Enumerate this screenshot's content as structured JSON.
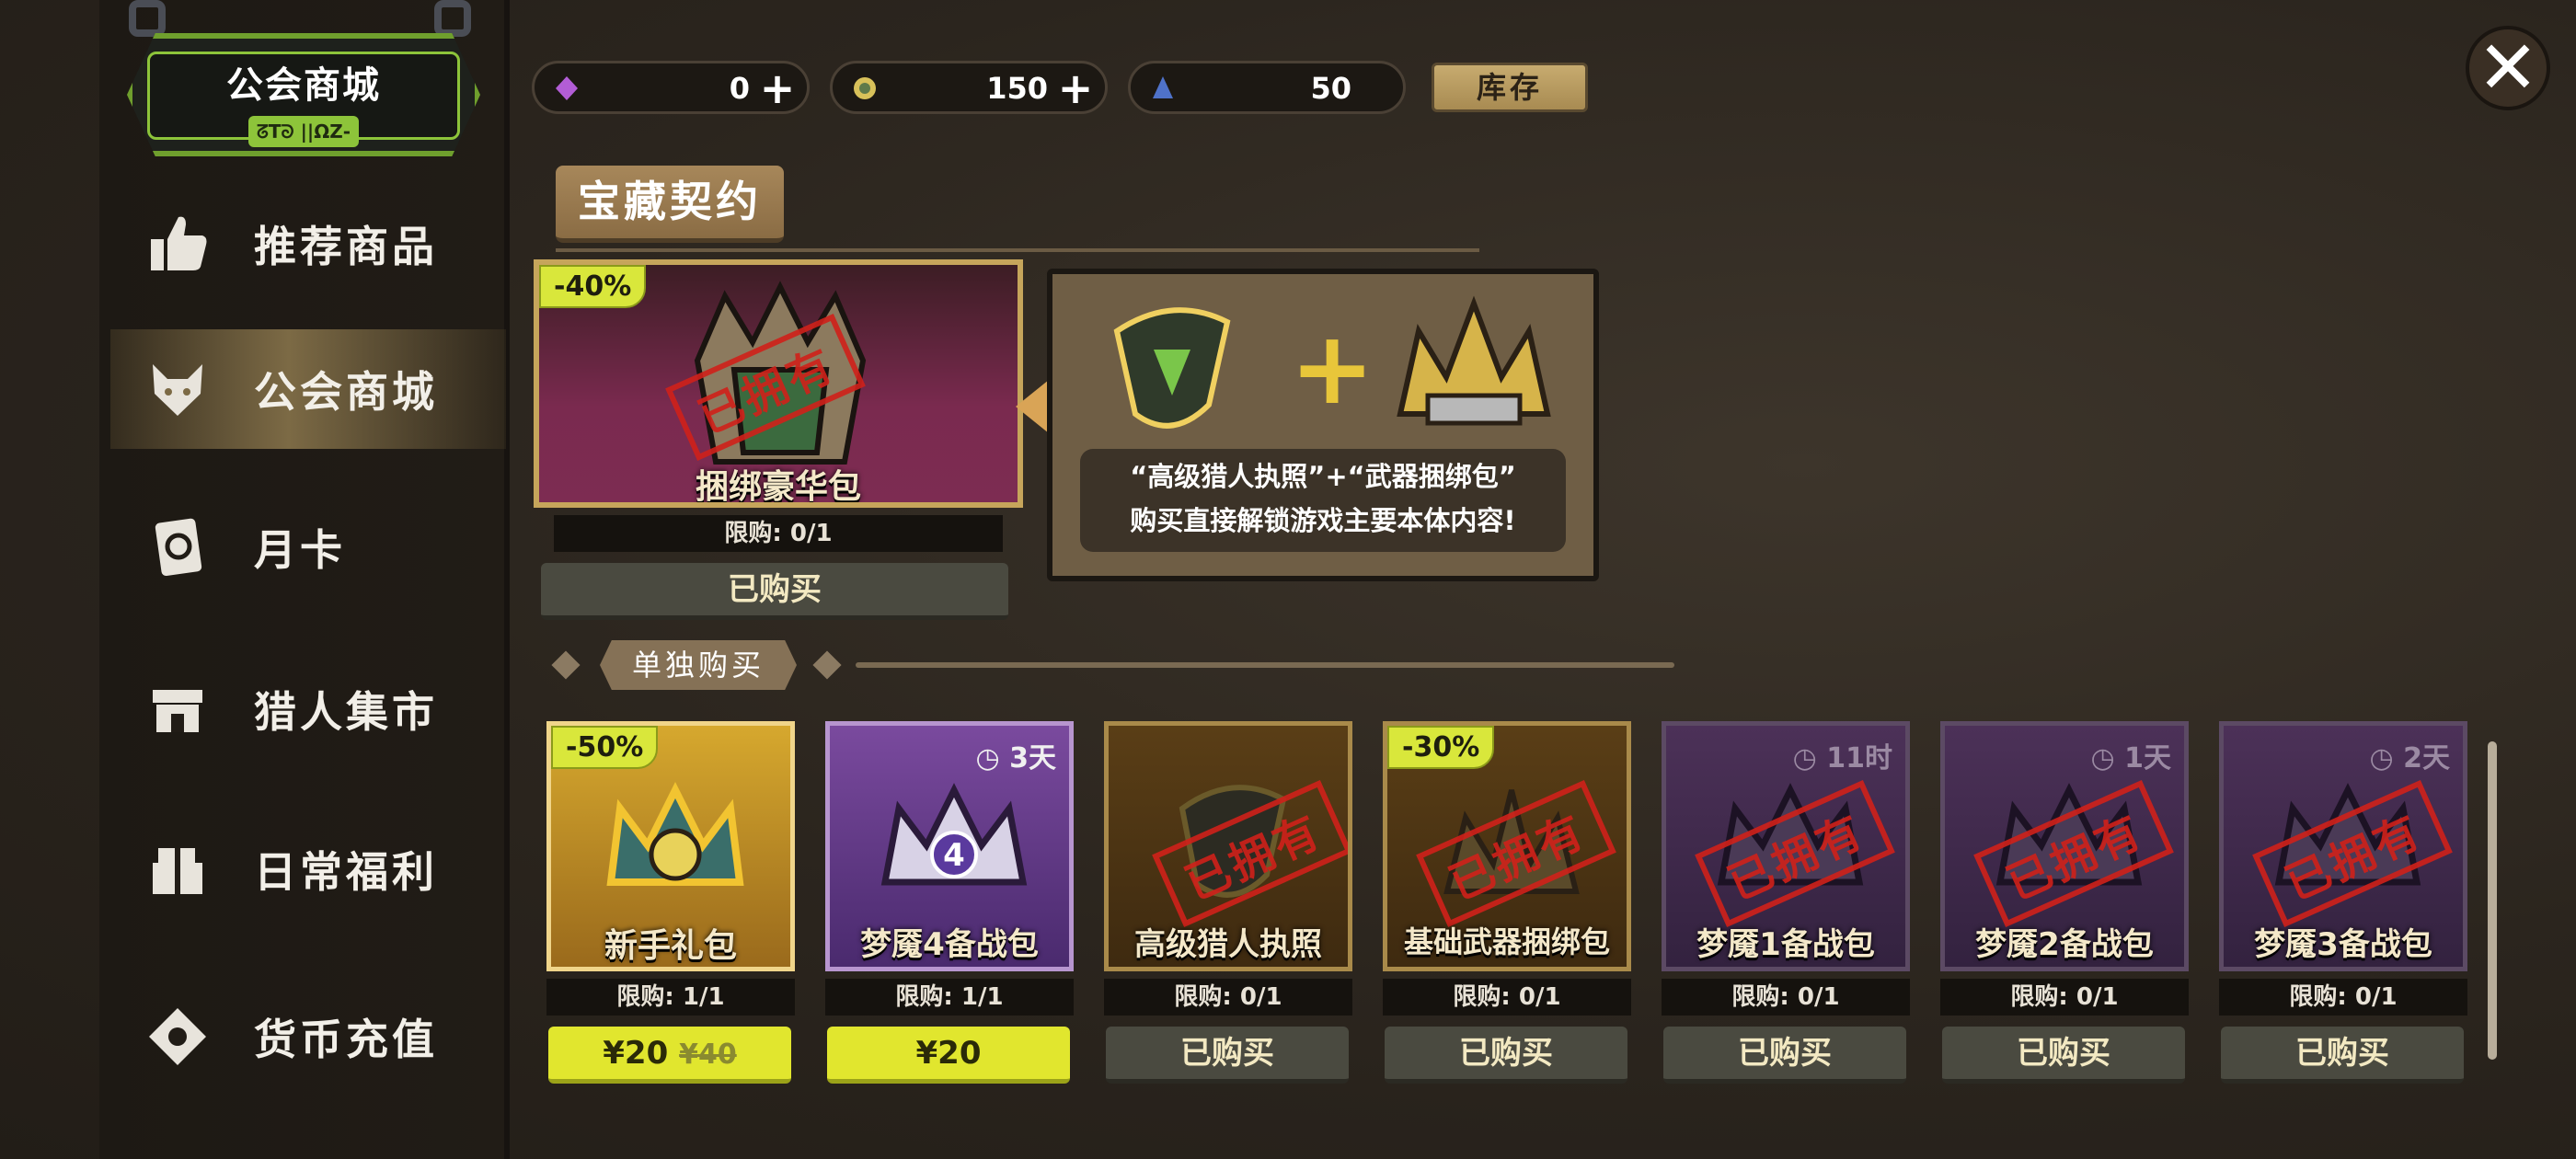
{
  "badge": {
    "title": "公会商城",
    "subtitle": "ᘔΤᘐ ||ΩΖ-"
  },
  "sidebar": {
    "items": [
      {
        "label": "推荐商品",
        "icon": "thumbs-up-icon"
      },
      {
        "label": "公会商城",
        "icon": "fox-icon",
        "active": true
      },
      {
        "label": "月卡",
        "icon": "card-icon"
      },
      {
        "label": "猎人集市",
        "icon": "stall-icon"
      },
      {
        "label": "日常福利",
        "icon": "gift-icon"
      },
      {
        "label": "货币充值",
        "icon": "currency-icon"
      }
    ]
  },
  "currency": [
    {
      "name": "gem",
      "value": "0",
      "icon": "purple-gem-icon",
      "color": "#b25dd6"
    },
    {
      "name": "coin",
      "value": "150",
      "icon": "guild-coin-icon",
      "color": "#d8c15a"
    },
    {
      "name": "token",
      "value": "50",
      "icon": "blue-token-icon",
      "color": "#4f72c9"
    }
  ],
  "stock_label": "库存",
  "close_label": "✕",
  "section": {
    "title": "宝藏契约"
  },
  "bundle": {
    "discount": "-40%",
    "name": "捆绑豪华包",
    "owned_stamp": "已拥有",
    "limit": "限购: 0/1",
    "button": "已购买"
  },
  "info": {
    "line1": "“高级猎人执照”+“武器捆绑包”",
    "line2": "购买直接解锁游戏主要本体内容!",
    "plus": "+"
  },
  "sub_section": {
    "title": "单独购买"
  },
  "items": [
    {
      "name": "新手礼包",
      "discount": "-50%",
      "limit": "限购: 1/1",
      "button_kind": "price",
      "price": "¥20",
      "orig_price": "¥40",
      "style": "gold",
      "icon": "gold-crown-icon"
    },
    {
      "name": "梦魇4备战包",
      "timer": "3天",
      "limit": "限购: 1/1",
      "button_kind": "price",
      "price": "¥20",
      "style": "purple",
      "icon": "nightmare-crown-4-icon"
    },
    {
      "name": "高级猎人执照",
      "limit": "限购: 0/1",
      "button_kind": "done",
      "button": "已购买",
      "owned": "已拥有",
      "style": "brown",
      "icon": "hunter-license-icon"
    },
    {
      "name": "基础武器捆绑包",
      "discount": "-30%",
      "limit": "限购: 0/1",
      "button_kind": "done",
      "button": "已购买",
      "owned": "已拥有",
      "style": "brown",
      "icon": "weapon-bundle-icon"
    },
    {
      "name": "梦魇1备战包",
      "timer": "11时",
      "limit": "限购: 0/1",
      "button_kind": "done",
      "button": "已购买",
      "owned": "已拥有",
      "style": "dpurple",
      "icon": "nightmare-crown-1-icon"
    },
    {
      "name": "梦魇2备战包",
      "timer": "1天",
      "limit": "限购: 0/1",
      "button_kind": "done",
      "button": "已购买",
      "owned": "已拥有",
      "style": "dpurple",
      "icon": "nightmare-crown-2-icon"
    },
    {
      "name": "梦魇3备战包",
      "timer": "2天",
      "limit": "限购: 0/1",
      "button_kind": "done",
      "button": "已购买",
      "owned": "已拥有",
      "style": "dpurple",
      "icon": "nightmare-crown-3-icon"
    }
  ]
}
